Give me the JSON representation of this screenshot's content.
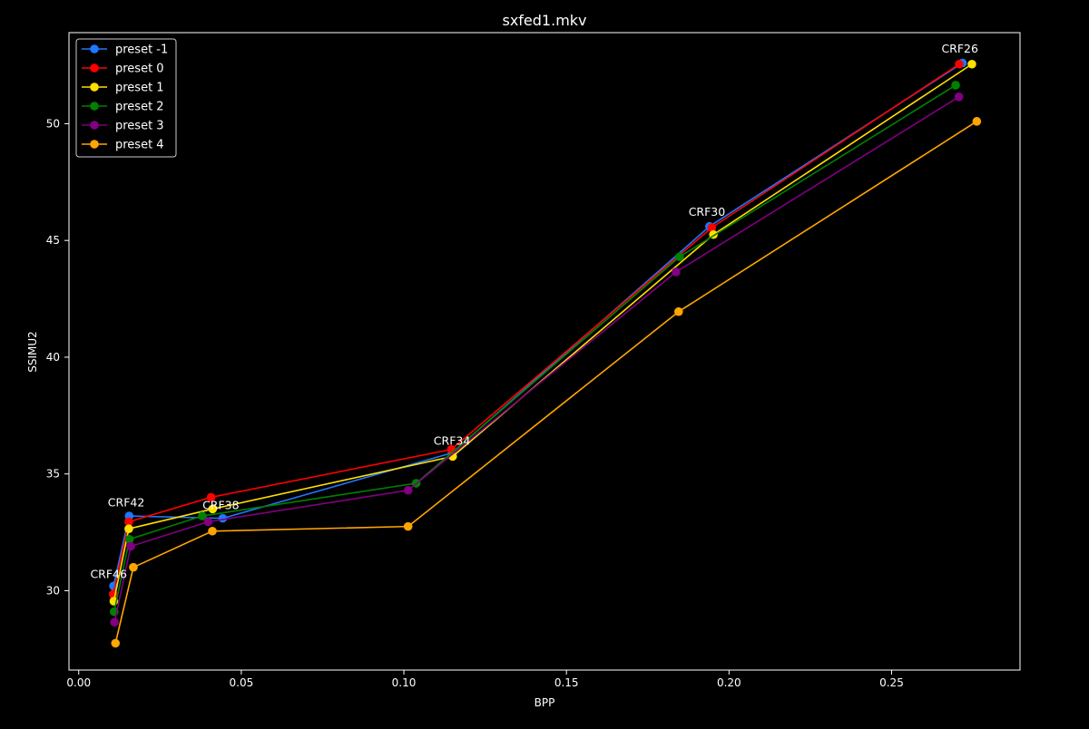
{
  "chart_data": {
    "type": "line",
    "title": "sxfed1.mkv",
    "xlabel": "BPP",
    "ylabel": "SSIMU2",
    "xlim": [
      -0.003,
      0.2895
    ],
    "ylim": [
      26.6,
      53.9
    ],
    "xticks": [
      0.0,
      0.05,
      0.1,
      0.15,
      0.2,
      0.25
    ],
    "xtick_labels": [
      "0.00",
      "0.05",
      "0.10",
      "0.15",
      "0.20",
      "0.25"
    ],
    "yticks": [
      30,
      35,
      40,
      45,
      50
    ],
    "ytick_labels": [
      "30",
      "35",
      "40",
      "45",
      "50"
    ],
    "grid": false,
    "legend_position": "top-left",
    "background": "#000000",
    "foreground": "#ffffff",
    "series": [
      {
        "name": "preset -1",
        "color": "#1f77ff",
        "x": [
          0.0107,
          0.0155,
          0.0443,
          0.1148,
          0.194,
          0.2718
        ],
        "y": [
          30.2,
          33.2,
          33.1,
          35.9,
          45.6,
          52.6
        ]
      },
      {
        "name": "preset 0",
        "color": "#ff0000",
        "x": [
          0.0106,
          0.0154,
          0.0407,
          0.1146,
          0.1947,
          0.2708
        ],
        "y": [
          29.85,
          32.95,
          34.0,
          36.05,
          45.55,
          52.55
        ]
      },
      {
        "name": "preset 1",
        "color": "#ffe000",
        "x": [
          0.0108,
          0.0154,
          0.0412,
          0.115,
          0.1952,
          0.2747
        ],
        "y": [
          29.55,
          32.65,
          33.5,
          35.75,
          45.25,
          52.55
        ]
      },
      {
        "name": "preset 2",
        "color": "#008000",
        "x": [
          0.0109,
          0.0156,
          0.038,
          0.1038,
          0.1848,
          0.2697
        ],
        "y": [
          29.1,
          32.2,
          33.2,
          34.6,
          44.3,
          51.65
        ]
      },
      {
        "name": "preset 3",
        "color": "#800080",
        "x": [
          0.011,
          0.016,
          0.0398,
          0.1013,
          0.1837,
          0.2707
        ],
        "y": [
          28.65,
          31.9,
          32.95,
          34.3,
          43.65,
          51.15
        ]
      },
      {
        "name": "preset 4",
        "color": "#ffa500",
        "x": [
          0.0113,
          0.0168,
          0.0411,
          0.1013,
          0.1845,
          0.2762
        ],
        "y": [
          27.75,
          31.0,
          32.55,
          32.75,
          41.95,
          50.1
        ]
      }
    ],
    "annotations": [
      {
        "text": "CRF46",
        "x": 0.0092,
        "y": 30.55
      },
      {
        "text": "CRF42",
        "x": 0.0146,
        "y": 33.6
      },
      {
        "text": "CRF38",
        "x": 0.0437,
        "y": 33.5
      },
      {
        "text": "CRF34",
        "x": 0.1148,
        "y": 36.25
      },
      {
        "text": "CRF30",
        "x": 0.1932,
        "y": 46.05
      },
      {
        "text": "CRF26",
        "x": 0.271,
        "y": 53.05
      }
    ]
  }
}
